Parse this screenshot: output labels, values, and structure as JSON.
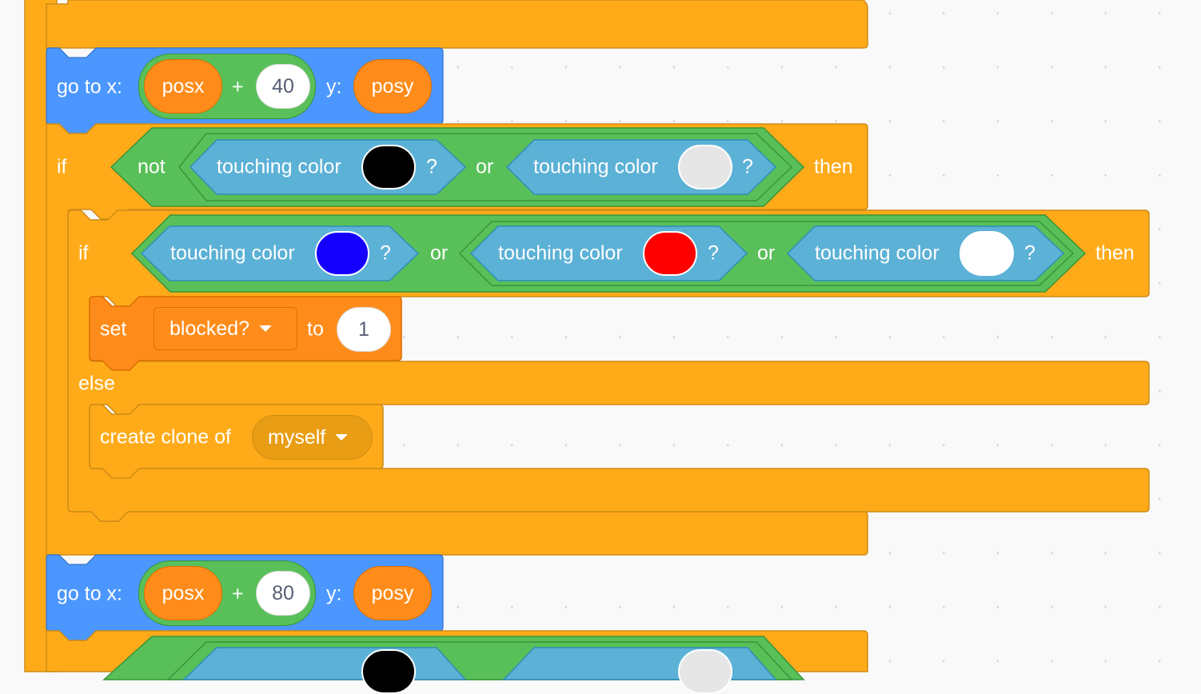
{
  "editor": "Scratch code area",
  "colors": {
    "control": "#ffab19",
    "control_dark": "#cf8b17",
    "motion": "#4c97ff",
    "operators": "#59c059",
    "sensing": "#5cb1d6",
    "variables": "#ff8c1a",
    "background": "#f9f9f9"
  },
  "blocks": {
    "goto1": {
      "label": "go to x:",
      "x_var": "posx",
      "plus": "+",
      "x_num": "40",
      "y_label": "y:",
      "y_var": "posy"
    },
    "if1": {
      "if": "if",
      "not": "not",
      "or": "or",
      "then": "then",
      "cond1": {
        "label": "touching color",
        "q": "?",
        "color": "#000000"
      },
      "cond2": {
        "label": "touching color",
        "q": "?",
        "color": "#e6e6e6"
      }
    },
    "if2": {
      "if": "if",
      "or1": "or",
      "or2": "or",
      "then": "then",
      "else": "else",
      "cond1": {
        "label": "touching color",
        "q": "?",
        "color": "#1500ff"
      },
      "cond2": {
        "label": "touching color",
        "q": "?",
        "color": "#ff0000"
      },
      "cond3": {
        "label": "touching color",
        "q": "?",
        "color": "#ffffff"
      }
    },
    "set": {
      "label": "set",
      "variable": "blocked?",
      "to": "to",
      "value": "1"
    },
    "clone": {
      "label": "create clone of",
      "target": "myself"
    },
    "goto2": {
      "label": "go to x:",
      "x_var": "posx",
      "plus": "+",
      "x_num": "80",
      "y_label": "y:",
      "y_var": "posy"
    }
  }
}
